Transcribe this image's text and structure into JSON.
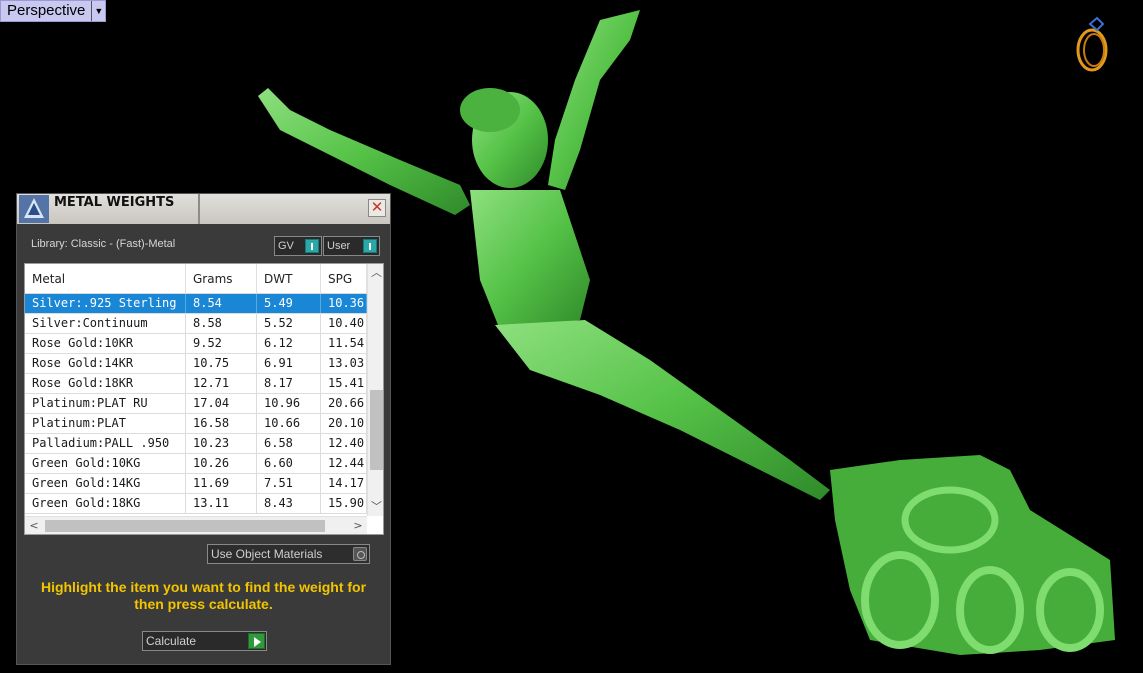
{
  "viewport": {
    "label": "Perspective",
    "dropdown_icon": "triangle-down",
    "background": "#000000",
    "model_color": "#5fcf4f"
  },
  "panel": {
    "title": "METAL WEIGHTS",
    "close_glyph": "✕",
    "library_label": "Library: Classic - (Fast)-Metal",
    "toggle_gv": "GV",
    "toggle_user": "User",
    "columns": [
      "Metal",
      "Grams",
      "DWT",
      "SPG"
    ],
    "rows": [
      [
        "Silver:.925 Sterling",
        "8.54",
        "5.49",
        "10.36"
      ],
      [
        "Silver:Continuum",
        "8.58",
        "5.52",
        "10.40"
      ],
      [
        "Rose Gold:10KR",
        "9.52",
        "6.12",
        "11.54"
      ],
      [
        "Rose Gold:14KR",
        "10.75",
        "6.91",
        "13.03"
      ],
      [
        "Rose Gold:18KR",
        "12.71",
        "8.17",
        "15.41"
      ],
      [
        "Platinum:PLAT RU",
        "17.04",
        "10.96",
        "20.66"
      ],
      [
        "Platinum:PLAT",
        "16.58",
        "10.66",
        "20.10"
      ],
      [
        "Palladium:PALL .950",
        "10.23",
        "6.58",
        "12.40"
      ],
      [
        "Green Gold:10KG",
        "10.26",
        "6.60",
        "12.44"
      ],
      [
        "Green Gold:14KG",
        "11.69",
        "7.51",
        "14.17"
      ],
      [
        "Green Gold:18KG",
        "13.11",
        "8.43",
        "15.90"
      ]
    ],
    "selected_row": 0,
    "use_object_materials": "Use Object Materials",
    "hint": "Highlight the item you want to find the weight for then press calculate.",
    "calculate_label": "Calculate",
    "accent_color": "#f2c500",
    "selection_color": "#1a86d6"
  }
}
